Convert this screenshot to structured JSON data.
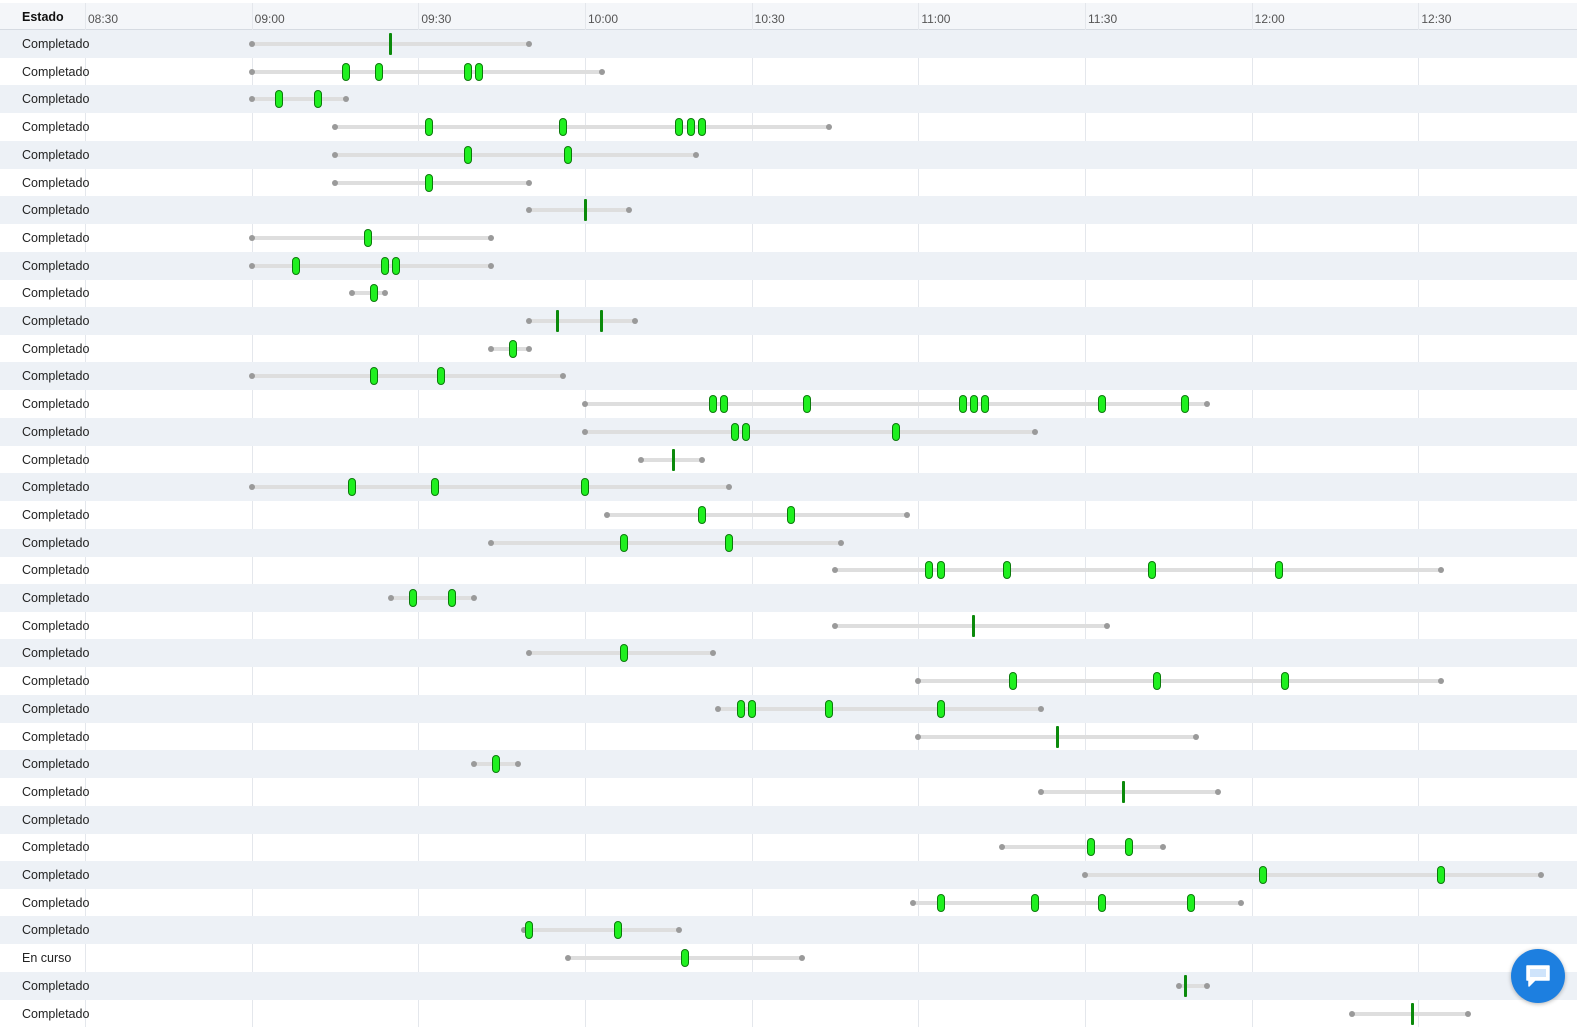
{
  "header": {
    "status_column": "Estado",
    "time_ticks": [
      "08:30",
      "09:00",
      "09:30",
      "10:00",
      "10:30",
      "11:00",
      "11:30",
      "12:00",
      "12:30"
    ]
  },
  "timeline": {
    "axis_start": "08:30",
    "axis_end": "12:50",
    "rows": [
      {
        "status": "Completado",
        "range": [
          "09:00",
          "09:50"
        ],
        "markers": [
          {
            "t": "09:25",
            "kind": "bar"
          }
        ]
      },
      {
        "status": "Completado",
        "range": [
          "09:00",
          "10:03"
        ],
        "markers": [
          {
            "t": "09:17",
            "kind": "pill"
          },
          {
            "t": "09:23",
            "kind": "pill"
          },
          {
            "t": "09:39",
            "kind": "pill"
          },
          {
            "t": "09:41",
            "kind": "pill"
          }
        ]
      },
      {
        "status": "Completado",
        "range": [
          "09:00",
          "09:17"
        ],
        "markers": [
          {
            "t": "09:05",
            "kind": "pill"
          },
          {
            "t": "09:12",
            "kind": "pill"
          }
        ]
      },
      {
        "status": "Completado",
        "range": [
          "09:15",
          "10:44"
        ],
        "markers": [
          {
            "t": "09:32",
            "kind": "pill"
          },
          {
            "t": "09:56",
            "kind": "pill"
          },
          {
            "t": "10:17",
            "kind": "pill"
          },
          {
            "t": "10:19",
            "kind": "pill"
          },
          {
            "t": "10:21",
            "kind": "pill"
          }
        ]
      },
      {
        "status": "Completado",
        "range": [
          "09:15",
          "10:20"
        ],
        "markers": [
          {
            "t": "09:39",
            "kind": "pill"
          },
          {
            "t": "09:57",
            "kind": "pill"
          }
        ]
      },
      {
        "status": "Completado",
        "range": [
          "09:15",
          "09:50"
        ],
        "markers": [
          {
            "t": "09:32",
            "kind": "pill"
          }
        ]
      },
      {
        "status": "Completado",
        "range": [
          "09:50",
          "10:08"
        ],
        "markers": [
          {
            "t": "10:00",
            "kind": "bar"
          }
        ]
      },
      {
        "status": "Completado",
        "range": [
          "09:00",
          "09:43"
        ],
        "markers": [
          {
            "t": "09:21",
            "kind": "pill"
          }
        ]
      },
      {
        "status": "Completado",
        "range": [
          "09:00",
          "09:43"
        ],
        "markers": [
          {
            "t": "09:08",
            "kind": "pill"
          },
          {
            "t": "09:24",
            "kind": "pill"
          },
          {
            "t": "09:26",
            "kind": "pill"
          }
        ]
      },
      {
        "status": "Completado",
        "range": [
          "09:18",
          "09:24"
        ],
        "markers": [
          {
            "t": "09:22",
            "kind": "pill"
          }
        ]
      },
      {
        "status": "Completado",
        "range": [
          "09:50",
          "10:09"
        ],
        "markers": [
          {
            "t": "09:55",
            "kind": "bar"
          },
          {
            "t": "10:03",
            "kind": "bar"
          }
        ]
      },
      {
        "status": "Completado",
        "range": [
          "09:43",
          "09:50"
        ],
        "markers": [
          {
            "t": "09:47",
            "kind": "pill"
          }
        ]
      },
      {
        "status": "Completado",
        "range": [
          "09:00",
          "09:56"
        ],
        "markers": [
          {
            "t": "09:22",
            "kind": "pill"
          },
          {
            "t": "09:34",
            "kind": "pill"
          }
        ]
      },
      {
        "status": "Completado",
        "range": [
          "10:00",
          "11:52"
        ],
        "markers": [
          {
            "t": "10:23",
            "kind": "pill"
          },
          {
            "t": "10:25",
            "kind": "pill"
          },
          {
            "t": "10:40",
            "kind": "pill"
          },
          {
            "t": "11:08",
            "kind": "pill"
          },
          {
            "t": "11:10",
            "kind": "pill"
          },
          {
            "t": "11:12",
            "kind": "pill"
          },
          {
            "t": "11:33",
            "kind": "pill"
          },
          {
            "t": "11:48",
            "kind": "pill"
          }
        ]
      },
      {
        "status": "Completado",
        "range": [
          "10:00",
          "11:21"
        ],
        "markers": [
          {
            "t": "10:27",
            "kind": "pill"
          },
          {
            "t": "10:29",
            "kind": "pill"
          },
          {
            "t": "10:56",
            "kind": "pill"
          }
        ]
      },
      {
        "status": "Completado",
        "range": [
          "10:10",
          "10:21"
        ],
        "markers": [
          {
            "t": "10:16",
            "kind": "bar"
          }
        ]
      },
      {
        "status": "Completado",
        "range": [
          "09:00",
          "10:26"
        ],
        "markers": [
          {
            "t": "09:18",
            "kind": "pill"
          },
          {
            "t": "09:33",
            "kind": "pill"
          },
          {
            "t": "10:00",
            "kind": "pill"
          }
        ]
      },
      {
        "status": "Completado",
        "range": [
          "10:04",
          "10:58"
        ],
        "markers": [
          {
            "t": "10:21",
            "kind": "pill"
          },
          {
            "t": "10:37",
            "kind": "pill"
          }
        ]
      },
      {
        "status": "Completado",
        "range": [
          "09:43",
          "10:46"
        ],
        "markers": [
          {
            "t": "10:07",
            "kind": "pill"
          },
          {
            "t": "10:26",
            "kind": "pill"
          }
        ]
      },
      {
        "status": "Completado",
        "range": [
          "10:45",
          "12:34"
        ],
        "markers": [
          {
            "t": "11:02",
            "kind": "pill"
          },
          {
            "t": "11:04",
            "kind": "pill"
          },
          {
            "t": "11:16",
            "kind": "pill"
          },
          {
            "t": "11:42",
            "kind": "pill"
          },
          {
            "t": "12:05",
            "kind": "pill"
          }
        ]
      },
      {
        "status": "Completado",
        "range": [
          "09:25",
          "09:40"
        ],
        "markers": [
          {
            "t": "09:29",
            "kind": "pill"
          },
          {
            "t": "09:36",
            "kind": "pill"
          }
        ]
      },
      {
        "status": "Completado",
        "range": [
          "10:45",
          "11:34"
        ],
        "markers": [
          {
            "t": "11:10",
            "kind": "bar"
          }
        ]
      },
      {
        "status": "Completado",
        "range": [
          "09:50",
          "10:23"
        ],
        "markers": [
          {
            "t": "10:07",
            "kind": "pill"
          }
        ]
      },
      {
        "status": "Completado",
        "range": [
          "11:00",
          "12:34"
        ],
        "markers": [
          {
            "t": "11:17",
            "kind": "pill"
          },
          {
            "t": "11:43",
            "kind": "pill"
          },
          {
            "t": "12:06",
            "kind": "pill"
          }
        ]
      },
      {
        "status": "Completado",
        "range": [
          "10:24",
          "11:22"
        ],
        "markers": [
          {
            "t": "10:28",
            "kind": "pill"
          },
          {
            "t": "10:30",
            "kind": "pill"
          },
          {
            "t": "10:44",
            "kind": "pill"
          },
          {
            "t": "11:04",
            "kind": "pill"
          }
        ]
      },
      {
        "status": "Completado",
        "range": [
          "11:00",
          "11:50"
        ],
        "markers": [
          {
            "t": "11:25",
            "kind": "bar"
          }
        ]
      },
      {
        "status": "Completado",
        "range": [
          "09:40",
          "09:48"
        ],
        "markers": [
          {
            "t": "09:44",
            "kind": "pill"
          }
        ]
      },
      {
        "status": "Completado",
        "range": [
          "11:22",
          "11:54"
        ],
        "markers": [
          {
            "t": "11:37",
            "kind": "bar"
          }
        ]
      },
      {
        "status": "Completado",
        "range": null,
        "markers": []
      },
      {
        "status": "Completado",
        "range": [
          "11:15",
          "11:44"
        ],
        "markers": [
          {
            "t": "11:31",
            "kind": "pill"
          },
          {
            "t": "11:38",
            "kind": "pill"
          }
        ]
      },
      {
        "status": "Completado",
        "range": [
          "11:30",
          "12:52"
        ],
        "markers": [
          {
            "t": "12:02",
            "kind": "pill"
          },
          {
            "t": "12:34",
            "kind": "pill"
          }
        ]
      },
      {
        "status": "Completado",
        "range": [
          "10:59",
          "11:58"
        ],
        "markers": [
          {
            "t": "11:04",
            "kind": "pill"
          },
          {
            "t": "11:21",
            "kind": "pill"
          },
          {
            "t": "11:33",
            "kind": "pill"
          },
          {
            "t": "11:49",
            "kind": "pill"
          }
        ]
      },
      {
        "status": "Completado",
        "range": [
          "09:49",
          "10:17"
        ],
        "markers": [
          {
            "t": "09:50",
            "kind": "pill"
          },
          {
            "t": "10:06",
            "kind": "pill"
          }
        ]
      },
      {
        "status": "En curso",
        "range": [
          "09:57",
          "10:39"
        ],
        "markers": [
          {
            "t": "10:18",
            "kind": "pill"
          }
        ]
      },
      {
        "status": "Completado",
        "range": [
          "11:47",
          "11:52"
        ],
        "markers": [
          {
            "t": "11:48",
            "kind": "bar"
          }
        ]
      },
      {
        "status": "Completado",
        "range": [
          "12:18",
          "12:39"
        ],
        "markers": [
          {
            "t": "12:29",
            "kind": "bar"
          }
        ]
      }
    ]
  },
  "chat": {
    "icon": "chat-bubble-icon",
    "color": "#1d7fe0"
  },
  "colors": {
    "marker_fill": "#1ff01f",
    "marker_border": "#0b7a0b",
    "bar_marker": "#0b8a0b",
    "range_line": "#dedede",
    "range_dot": "#9a9a9a",
    "row_alt": "#edf1f6"
  }
}
